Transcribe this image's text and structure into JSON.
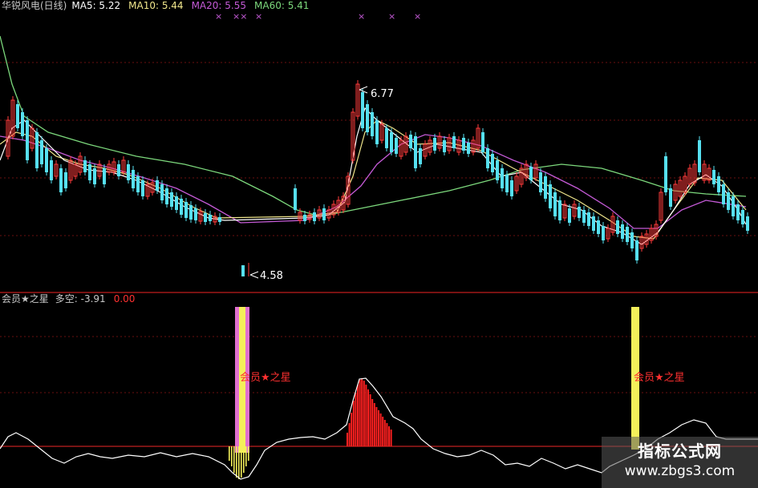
{
  "upper": {
    "title": "华锐风电(日线)",
    "ma5": "MA5: 5.22",
    "ma10": "MA10: 5.44",
    "ma20": "MA20: 5.55",
    "ma60": "MA60: 5.41",
    "high_label": "6.77",
    "low_label": "4.58",
    "marks": [
      "×",
      "××",
      "×",
      "×",
      "×",
      "×"
    ]
  },
  "lower": {
    "title": "会员★之星",
    "duokong_label": "多空: -3.91",
    "extra_value": "0.00",
    "signal_label_1": "会员★之星",
    "signal_label_2": "会员★之星"
  },
  "watermark": {
    "line1": "指标公式网",
    "line2": "www.zbgs3.com"
  },
  "colors": {
    "bg": "#000000",
    "up": "#ff3b3b",
    "down": "#56e0f0",
    "ma5": "#ffffff",
    "ma10": "#f0e68c",
    "ma20": "#c45ad6",
    "ma60": "#7cd87c",
    "axis_red": "#a01818",
    "signal_yellow": "#f4f05a",
    "signal_pink": "#e070d0",
    "signal_red": "#ff2020"
  }
}
